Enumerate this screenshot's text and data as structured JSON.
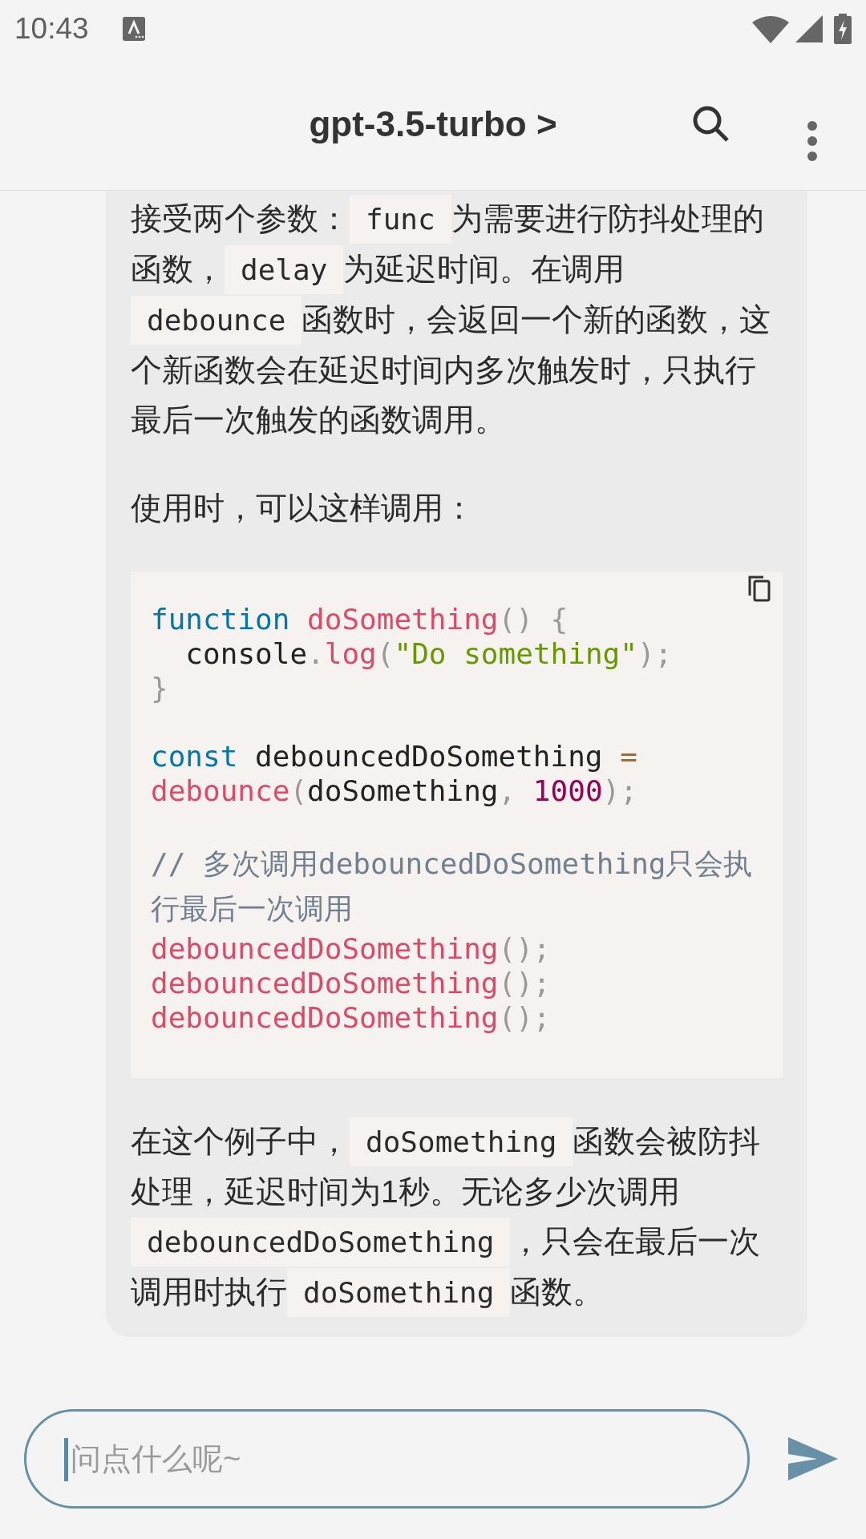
{
  "status_bar": {
    "time": "10:43"
  },
  "header": {
    "title": "gpt-3.5-turbo >"
  },
  "message": {
    "blocks": [
      {
        "kind": "paragraph",
        "segments": [
          {
            "kind": "text",
            "text": "接受两个参数："
          },
          {
            "kind": "code",
            "text": "func"
          },
          {
            "kind": "text",
            "text": "为需要进行防抖处理的函数，"
          },
          {
            "kind": "code",
            "text": "delay"
          },
          {
            "kind": "text",
            "text": "为延迟时间。在调用"
          },
          {
            "kind": "code",
            "text": "debounce"
          },
          {
            "kind": "text",
            "text": "函数时，会返回一个新的函数，这个新函数会在延迟时间内多次触发时，只执行最后一次触发的函数调用。"
          }
        ]
      },
      {
        "kind": "paragraph",
        "segments": [
          {
            "kind": "text",
            "text": "使用时，可以这样调用："
          }
        ]
      },
      {
        "kind": "code_block",
        "groups": [
          [
            [
              {
                "kind": "keyword",
                "text": "function "
              },
              {
                "kind": "function",
                "text": "doSomething"
              },
              {
                "kind": "punct",
                "text": "() {"
              }
            ],
            [
              {
                "kind": "plain",
                "text": "  console"
              },
              {
                "kind": "punct",
                "text": "."
              },
              {
                "kind": "function",
                "text": "log"
              },
              {
                "kind": "punct",
                "text": "("
              },
              {
                "kind": "string",
                "text": "\"Do something\""
              },
              {
                "kind": "punct",
                "text": ");"
              }
            ],
            [
              {
                "kind": "punct",
                "text": "}"
              }
            ]
          ],
          [
            [
              {
                "kind": "keyword",
                "text": "const"
              },
              {
                "kind": "plain",
                "text": " debouncedDoSomething "
              },
              {
                "kind": "operator",
                "text": "="
              }
            ],
            [
              {
                "kind": "function",
                "text": "debounce"
              },
              {
                "kind": "punct",
                "text": "("
              },
              {
                "kind": "plain",
                "text": "doSomething"
              },
              {
                "kind": "punct",
                "text": ", "
              },
              {
                "kind": "number",
                "text": "1000"
              },
              {
                "kind": "punct",
                "text": ");"
              }
            ]
          ],
          [
            [
              {
                "kind": "comment",
                "text": "// 多次调用debouncedDoSomething只会执行最后一次调用"
              }
            ],
            [
              {
                "kind": "function",
                "text": "debouncedDoSomething"
              },
              {
                "kind": "punct",
                "text": "();"
              }
            ],
            [
              {
                "kind": "function",
                "text": "debouncedDoSomething"
              },
              {
                "kind": "punct",
                "text": "();"
              }
            ],
            [
              {
                "kind": "function",
                "text": "debouncedDoSomething"
              },
              {
                "kind": "punct",
                "text": "();"
              }
            ]
          ]
        ]
      },
      {
        "kind": "paragraph",
        "segments": [
          {
            "kind": "text",
            "text": "在这个例子中，"
          },
          {
            "kind": "code",
            "text": "doSomething"
          },
          {
            "kind": "text",
            "text": "函数会被防抖处理，延迟时间为1秒。无论多少次调用"
          },
          {
            "kind": "code",
            "text": "debouncedDoSomething"
          },
          {
            "kind": "text",
            "text": "，只会在最后一次调用时执行"
          },
          {
            "kind": "code",
            "text": "doSomething"
          },
          {
            "kind": "text",
            "text": "函数。"
          }
        ]
      }
    ]
  },
  "composer": {
    "placeholder": "问点什么呢~"
  }
}
